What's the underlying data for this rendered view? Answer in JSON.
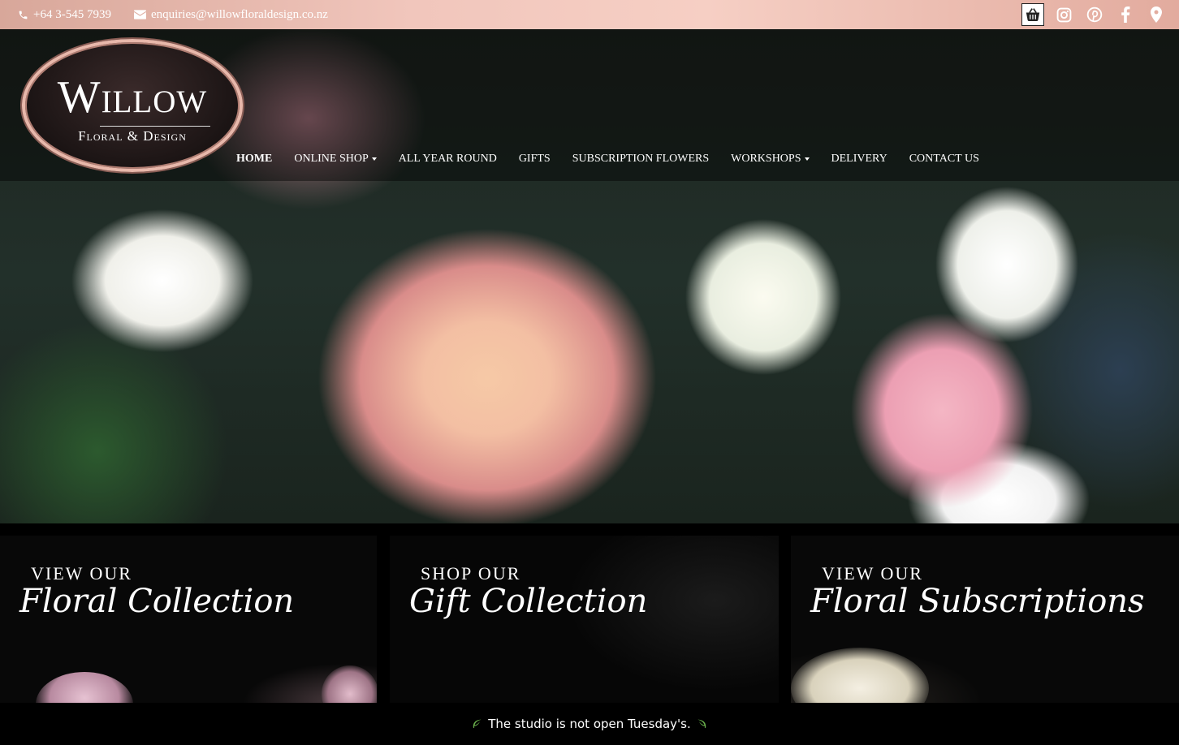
{
  "topbar": {
    "phone": "+64 3-545 7939",
    "email": "enquiries@willowfloraldesign.co.nz",
    "icons": [
      "basket-icon",
      "instagram-icon",
      "pinterest-icon",
      "facebook-icon",
      "map-pin-icon"
    ]
  },
  "logo": {
    "word": "Willow",
    "sub": "Floral & Design"
  },
  "nav": {
    "items": [
      {
        "label": "HOME",
        "active": true,
        "dropdown": false
      },
      {
        "label": "ONLINE SHOP",
        "dropdown": true
      },
      {
        "label": "ALL YEAR ROUND",
        "dropdown": false
      },
      {
        "label": "GIFTS",
        "dropdown": false
      },
      {
        "label": "SUBSCRIPTION FLOWERS",
        "dropdown": false
      },
      {
        "label": "WORKSHOPS",
        "dropdown": true
      },
      {
        "label": "DELIVERY",
        "dropdown": false
      },
      {
        "label": "CONTACT US",
        "dropdown": false
      }
    ]
  },
  "panels": [
    {
      "kicker": "VIEW OUR",
      "script": "Floral Collection"
    },
    {
      "kicker": "SHOP OUR",
      "script": "Gift Collection"
    },
    {
      "kicker": "VIEW OUR",
      "script": "Floral Subscriptions"
    }
  ],
  "notice": {
    "text": "The studio is not open Tuesday's."
  },
  "colors": {
    "topbar": "#f1c6bc",
    "logo_border": "#e8b8ab",
    "notice_bg": "#000000",
    "leaf": "#6ab04c"
  }
}
